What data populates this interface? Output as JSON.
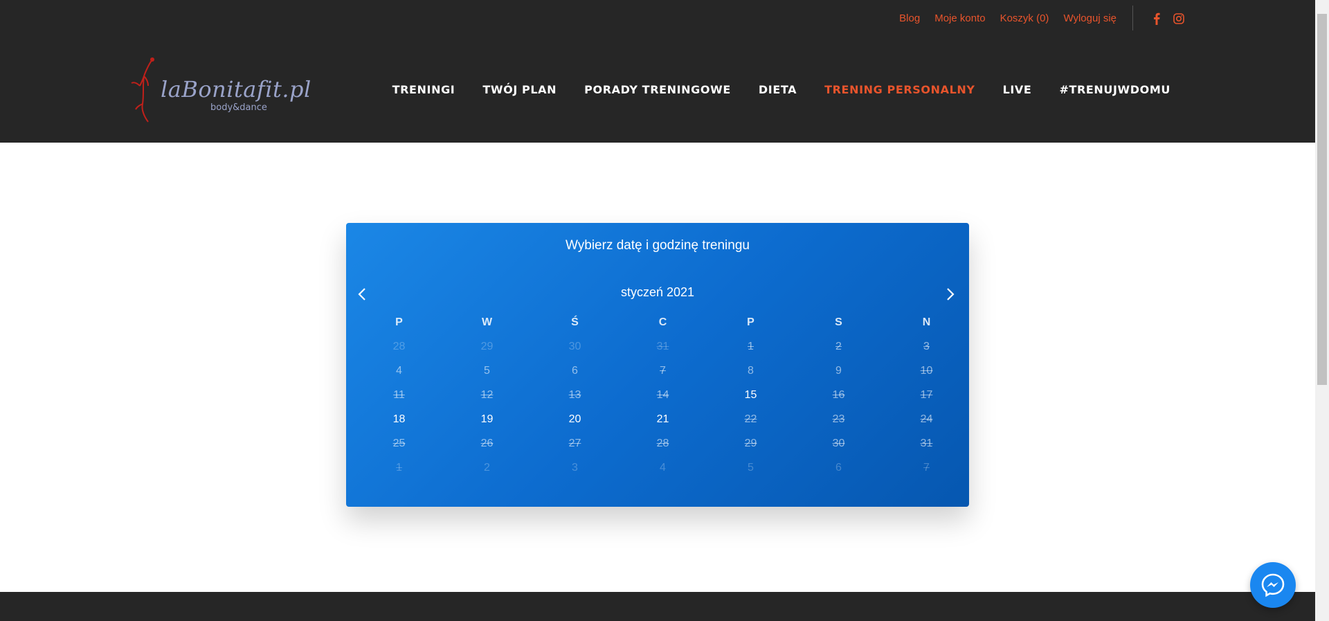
{
  "top_links": [
    {
      "label": "Blog"
    },
    {
      "label": "Moje konto"
    },
    {
      "label": "Koszyk (0)"
    },
    {
      "label": "Wyloguj się"
    }
  ],
  "logo": {
    "main": "laBonitafit.pl",
    "sub": "body&dance"
  },
  "nav": [
    {
      "label": "TRENINGI"
    },
    {
      "label": "TWÓJ PLAN"
    },
    {
      "label": "PORADY TRENINGOWE"
    },
    {
      "label": "DIETA"
    },
    {
      "label": "TRENING PERSONALNY"
    },
    {
      "label": "LIVE"
    },
    {
      "label": "#TRENUJWDOMU"
    }
  ],
  "colors": {
    "accent": "#e8542c",
    "header_bg": "#262626",
    "calendar_blue": "#0d6ccf",
    "messenger": "#1a87f0"
  },
  "calendar": {
    "title": "Wybierz datę i godzinę treningu",
    "month": "styczeń 2021",
    "weekdays": [
      "P",
      "W",
      "Ś",
      "C",
      "P",
      "S",
      "N"
    ],
    "weeks": [
      [
        {
          "d": "28",
          "s": "other"
        },
        {
          "d": "29",
          "s": "other"
        },
        {
          "d": "30",
          "s": "other"
        },
        {
          "d": "31",
          "s": "other-strike"
        },
        {
          "d": "1",
          "s": "strike"
        },
        {
          "d": "2",
          "s": "strike"
        },
        {
          "d": "3",
          "s": "strike"
        }
      ],
      [
        {
          "d": "4",
          "s": "unavail"
        },
        {
          "d": "5",
          "s": "unavail"
        },
        {
          "d": "6",
          "s": "unavail"
        },
        {
          "d": "7",
          "s": "strike"
        },
        {
          "d": "8",
          "s": "unavail"
        },
        {
          "d": "9",
          "s": "unavail"
        },
        {
          "d": "10",
          "s": "strike"
        }
      ],
      [
        {
          "d": "11",
          "s": "strike"
        },
        {
          "d": "12",
          "s": "strike"
        },
        {
          "d": "13",
          "s": "strike"
        },
        {
          "d": "14",
          "s": "strike"
        },
        {
          "d": "15",
          "s": "avail"
        },
        {
          "d": "16",
          "s": "strike"
        },
        {
          "d": "17",
          "s": "strike"
        }
      ],
      [
        {
          "d": "18",
          "s": "avail"
        },
        {
          "d": "19",
          "s": "avail"
        },
        {
          "d": "20",
          "s": "avail"
        },
        {
          "d": "21",
          "s": "avail"
        },
        {
          "d": "22",
          "s": "strike"
        },
        {
          "d": "23",
          "s": "strike"
        },
        {
          "d": "24",
          "s": "strike"
        }
      ],
      [
        {
          "d": "25",
          "s": "strike"
        },
        {
          "d": "26",
          "s": "strike"
        },
        {
          "d": "27",
          "s": "strike"
        },
        {
          "d": "28",
          "s": "strike"
        },
        {
          "d": "29",
          "s": "strike"
        },
        {
          "d": "30",
          "s": "strike"
        },
        {
          "d": "31",
          "s": "strike"
        }
      ],
      [
        {
          "d": "1",
          "s": "other-strike"
        },
        {
          "d": "2",
          "s": "other"
        },
        {
          "d": "3",
          "s": "other"
        },
        {
          "d": "4",
          "s": "other"
        },
        {
          "d": "5",
          "s": "other"
        },
        {
          "d": "6",
          "s": "other"
        },
        {
          "d": "7",
          "s": "other-strike"
        }
      ]
    ]
  }
}
